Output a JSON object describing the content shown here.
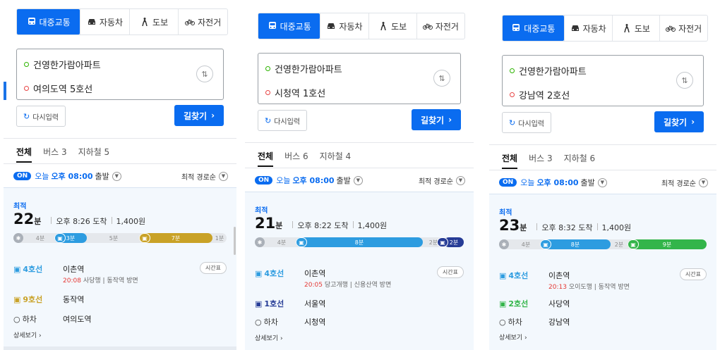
{
  "tabs": {
    "transit": "대중교통",
    "car": "자동차",
    "walk": "도보",
    "bike": "자전거"
  },
  "common": {
    "reset_label": "다시입력",
    "search_label": "길찾기",
    "filter_all": "전체",
    "on_badge": "ON",
    "today": "오늘",
    "depart_time": "오후 08:00",
    "depart_suffix": "출발",
    "sort_label": "최적 경로순",
    "best_label": "최적",
    "minute_unit": "분",
    "timetable_label": "시간표",
    "alight_label": "하차",
    "detail_label": "상세보기"
  },
  "colors": {
    "accent": "#0a6cf0",
    "line4": "#2d9ce0",
    "line9": "#c9a227",
    "line1": "#263c96",
    "line2": "#33b54a"
  },
  "panels": [
    {
      "origin": "건영한가람아파트",
      "destination": "여의도역 5호선",
      "filter_bus": "버스 3",
      "filter_subway": "지하철 5",
      "duration": "22",
      "arrival": "오후 8:26 도착",
      "fare": "1,400원",
      "progress": {
        "walk1": "4분",
        "ride1": "3분",
        "walk2": "5분",
        "ride2": "7분",
        "walk3": "1분"
      },
      "leg1": {
        "line": "4호선",
        "station": "이촌역",
        "time": "20:08",
        "direction": "사당행 | 동작역 방면"
      },
      "leg2": {
        "line": "9호선",
        "station": "동작역"
      },
      "alight_station": "여의도역"
    },
    {
      "origin": "건영한가람아파트",
      "destination": "시청역 1호선",
      "filter_bus": "버스 6",
      "filter_subway": "지하철 4",
      "duration": "21",
      "arrival": "오후 8:22 도착",
      "fare": "1,400원",
      "progress": {
        "walk1": "4분",
        "ride1": "8분",
        "walk2": "2분",
        "ride2": "2분"
      },
      "leg1": {
        "line": "4호선",
        "station": "이촌역",
        "time": "20:05",
        "direction": "당고개행 | 신용산역 방면"
      },
      "leg2": {
        "line": "1호선",
        "station": "서울역"
      },
      "alight_station": "시청역"
    },
    {
      "origin": "건영한가람아파트",
      "destination": "강남역 2호선",
      "filter_bus": "버스 3",
      "filter_subway": "지하철 6",
      "duration": "23",
      "arrival": "오후 8:32 도착",
      "fare": "1,400원",
      "progress": {
        "walk1": "4분",
        "ride1": "8분",
        "walk2": "2분",
        "ride2": "9분"
      },
      "leg1": {
        "line": "4호선",
        "station": "이촌역",
        "time": "20:13",
        "direction": "오이도행 | 동작역 방면"
      },
      "leg2": {
        "line": "2호선",
        "station": "사당역"
      },
      "alight_station": "강남역"
    }
  ]
}
